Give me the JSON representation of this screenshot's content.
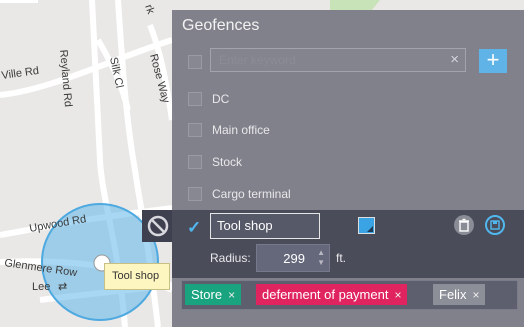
{
  "map": {
    "roads": [
      "Ville Rd",
      "Reyland Rd",
      "Silk Cl",
      "Rose Way",
      "Upwood Rd",
      "Glenmere Row",
      "Lee",
      "rk"
    ],
    "marker_tooltip": "Tool shop"
  },
  "panel": {
    "title": "Geofences",
    "search": {
      "placeholder": "Enter keyword",
      "clear_icon": "×"
    },
    "add_icon": "+",
    "items": [
      {
        "label": "DC"
      },
      {
        "label": "Main office"
      },
      {
        "label": "Stock"
      },
      {
        "label": "Cargo terminal"
      }
    ],
    "editing": {
      "name": "Tool shop",
      "checked": true,
      "color": "#3aa3e3",
      "radius_label": "Radius:",
      "radius_value": "299",
      "radius_unit": "ft."
    },
    "tags": [
      {
        "label": "Store",
        "color": "#1aa37f"
      },
      {
        "label": "deferment of payment",
        "color": "#e0245f"
      },
      {
        "label": "Felix",
        "color": "#8c8e98"
      }
    ]
  }
}
